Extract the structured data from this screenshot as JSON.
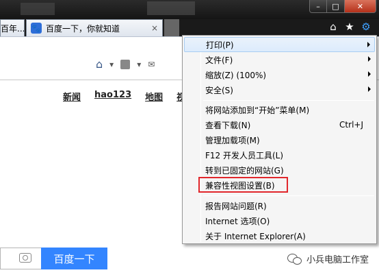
{
  "tabs": [
    {
      "title": "百年..."
    },
    {
      "title": "百度一下，你就知道",
      "close": "×"
    }
  ],
  "window_controls": {
    "min": "–",
    "max": "□",
    "close": "✕"
  },
  "toolbar_icons": {
    "home": "⌂",
    "favorites": "★",
    "tools": "⚙"
  },
  "nav_links": [
    "新闻",
    "hao123",
    "地图",
    "视"
  ],
  "search": {
    "button_label": "百度一下"
  },
  "watermark": "小兵电脑工作室",
  "menu": {
    "items": [
      {
        "label": "打印(P)",
        "submenu": true
      },
      {
        "label": "文件(F)",
        "submenu": true
      },
      {
        "label": "缩放(Z) (100%)",
        "submenu": true
      },
      {
        "label": "安全(S)",
        "submenu": true
      },
      {
        "label": "将网站添加到“开始”菜单(M)"
      },
      {
        "label": "查看下载(N)",
        "shortcut": "Ctrl+J"
      },
      {
        "label": "管理加载项(M)"
      },
      {
        "label": "F12 开发人员工具(L)"
      },
      {
        "label": "转到已固定的网站(G)"
      },
      {
        "label": "兼容性视图设置(B)"
      },
      {
        "label": "报告网站问题(R)"
      },
      {
        "label": "Internet 选项(O)"
      },
      {
        "label": "关于 Internet Explorer(A)"
      }
    ]
  },
  "colors": {
    "highlight_box": "#e1262b",
    "search_button": "#3385ff"
  }
}
